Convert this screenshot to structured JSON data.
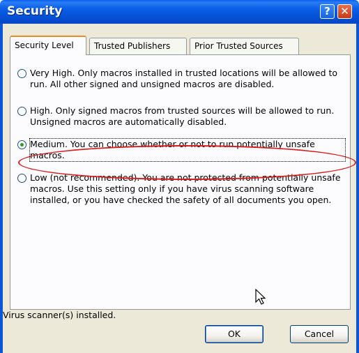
{
  "dialog": {
    "title": "Security",
    "help_icon": "?",
    "close_icon": "✕"
  },
  "tabs": [
    {
      "label": "Security Level",
      "active": true
    },
    {
      "label": "Trusted Publishers",
      "active": false
    },
    {
      "label": "Prior Trusted Sources",
      "active": false
    }
  ],
  "security_options": [
    {
      "label": "Very High. Only macros installed in trusted locations will be allowed to run. All other signed and unsigned macros are disabled.",
      "selected": false
    },
    {
      "label": "High. Only signed macros from trusted sources will be allowed to run. Unsigned macros are automatically disabled.",
      "selected": false
    },
    {
      "label": "Medium. You can choose whether or not to run potentially unsafe macros.",
      "selected": true
    },
    {
      "label": "Low (not recommended). You are not protected from potentially unsafe macros. Use this setting only if you have virus scanning software installed, or you have checked the safety of all documents you open.",
      "selected": false
    }
  ],
  "status_text": "Virus scanner(s) installed.",
  "buttons": {
    "ok": "OK",
    "cancel": "Cancel"
  },
  "colors": {
    "title_bar": "#0551d6",
    "highlight_ellipse": "#d61e1e",
    "active_tab_accent": "#e68b2c"
  }
}
